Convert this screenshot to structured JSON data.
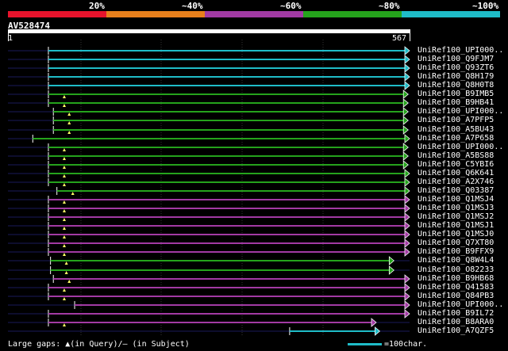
{
  "query": {
    "id": "AV528474",
    "start": "1",
    "end": "567"
  },
  "scale": [
    {
      "label": "20%",
      "color": "#e8132c"
    },
    {
      "label": "~40%",
      "color": "#e8801c"
    },
    {
      "label": "~60%",
      "color": "#a23aa4"
    },
    {
      "label": "~80%",
      "color": "#25a31c"
    },
    {
      "label": "~100%",
      "color": "#1fbcc8"
    }
  ],
  "colors": {
    "cyan": "#1fbcc8",
    "green": "#25a31c",
    "purple": "#a23aa4",
    "guide": "#1a1a5a"
  },
  "hits": [
    {
      "label": "UniRef100_UPI000..",
      "color": "cyan",
      "start": 58,
      "end": 567,
      "gap": false
    },
    {
      "label": "UniRef100_Q9FJM7",
      "color": "cyan",
      "start": 58,
      "end": 567,
      "gap": false
    },
    {
      "label": "UniRef100_Q93ZT6",
      "color": "cyan",
      "start": 58,
      "end": 567,
      "gap": false
    },
    {
      "label": "UniRef100_Q8H179",
      "color": "cyan",
      "start": 58,
      "end": 567,
      "gap": false
    },
    {
      "label": "UniRef100_Q8H0T8",
      "color": "cyan",
      "start": 58,
      "end": 567,
      "gap": false
    },
    {
      "label": "UniRef100_B9IMB5",
      "color": "green",
      "start": 58,
      "end": 565,
      "gap": true
    },
    {
      "label": "UniRef100_B9HB41",
      "color": "green",
      "start": 58,
      "end": 565,
      "gap": true
    },
    {
      "label": "UniRef100_UPI000..",
      "color": "green",
      "start": 65,
      "end": 565,
      "gap": true
    },
    {
      "label": "UniRef100_A7PFP5",
      "color": "green",
      "start": 65,
      "end": 565,
      "gap": true
    },
    {
      "label": "UniRef100_A5BU43",
      "color": "green",
      "start": 65,
      "end": 565,
      "gap": true
    },
    {
      "label": "UniRef100_A7P658",
      "color": "green",
      "start": 36,
      "end": 567,
      "gap": false
    },
    {
      "label": "UniRef100_UPI000..",
      "color": "green",
      "start": 58,
      "end": 565,
      "gap": true
    },
    {
      "label": "UniRef100_A5BS88",
      "color": "green",
      "start": 58,
      "end": 565,
      "gap": true
    },
    {
      "label": "UniRef100_C5YBI6",
      "color": "green",
      "start": 58,
      "end": 565,
      "gap": true
    },
    {
      "label": "UniRef100_Q6K641",
      "color": "green",
      "start": 58,
      "end": 567,
      "gap": true
    },
    {
      "label": "UniRef100_A2X746",
      "color": "green",
      "start": 58,
      "end": 567,
      "gap": true
    },
    {
      "label": "UniRef100_Q03387",
      "color": "green",
      "start": 70,
      "end": 567,
      "gap": true
    },
    {
      "label": "UniRef100_Q1MSJ4",
      "color": "purple",
      "start": 58,
      "end": 567,
      "gap": true
    },
    {
      "label": "UniRef100_Q1MSJ3",
      "color": "purple",
      "start": 58,
      "end": 567,
      "gap": true
    },
    {
      "label": "UniRef100_Q1MSJ2",
      "color": "purple",
      "start": 58,
      "end": 567,
      "gap": true
    },
    {
      "label": "UniRef100_Q1MSJ1",
      "color": "purple",
      "start": 58,
      "end": 567,
      "gap": true
    },
    {
      "label": "UniRef100_Q1MSJ0",
      "color": "purple",
      "start": 58,
      "end": 567,
      "gap": true
    },
    {
      "label": "UniRef100_Q7XT80",
      "color": "purple",
      "start": 58,
      "end": 567,
      "gap": true
    },
    {
      "label": "UniRef100_B9FFX9",
      "color": "purple",
      "start": 58,
      "end": 567,
      "gap": true
    },
    {
      "label": "UniRef100_Q8W4L4",
      "color": "green",
      "start": 61,
      "end": 545,
      "gap": true
    },
    {
      "label": "UniRef100_O82233",
      "color": "green",
      "start": 61,
      "end": 545,
      "gap": true
    },
    {
      "label": "UniRef100_B9HB68",
      "color": "purple",
      "start": 65,
      "end": 567,
      "gap": true
    },
    {
      "label": "UniRef100_Q41583",
      "color": "purple",
      "start": 58,
      "end": 567,
      "gap": true
    },
    {
      "label": "UniRef100_Q84PB3",
      "color": "purple",
      "start": 58,
      "end": 567,
      "gap": true
    },
    {
      "label": "UniRef100_UPI000..",
      "color": "purple",
      "start": 95,
      "end": 567,
      "gap": false
    },
    {
      "label": "UniRef100_B9IL72",
      "color": "purple",
      "start": 58,
      "end": 567,
      "gap": false
    },
    {
      "label": "UniRef100_B8ARA0",
      "color": "purple",
      "start": 58,
      "end": 520,
      "gap": true
    },
    {
      "label": "UniRef100_A7QZF5",
      "color": "cyan",
      "start": 398,
      "end": 525,
      "gap": false
    }
  ],
  "footer": {
    "left": "Large gaps: ▲(in Query)/– (in Subject)",
    "right": "=100char."
  }
}
